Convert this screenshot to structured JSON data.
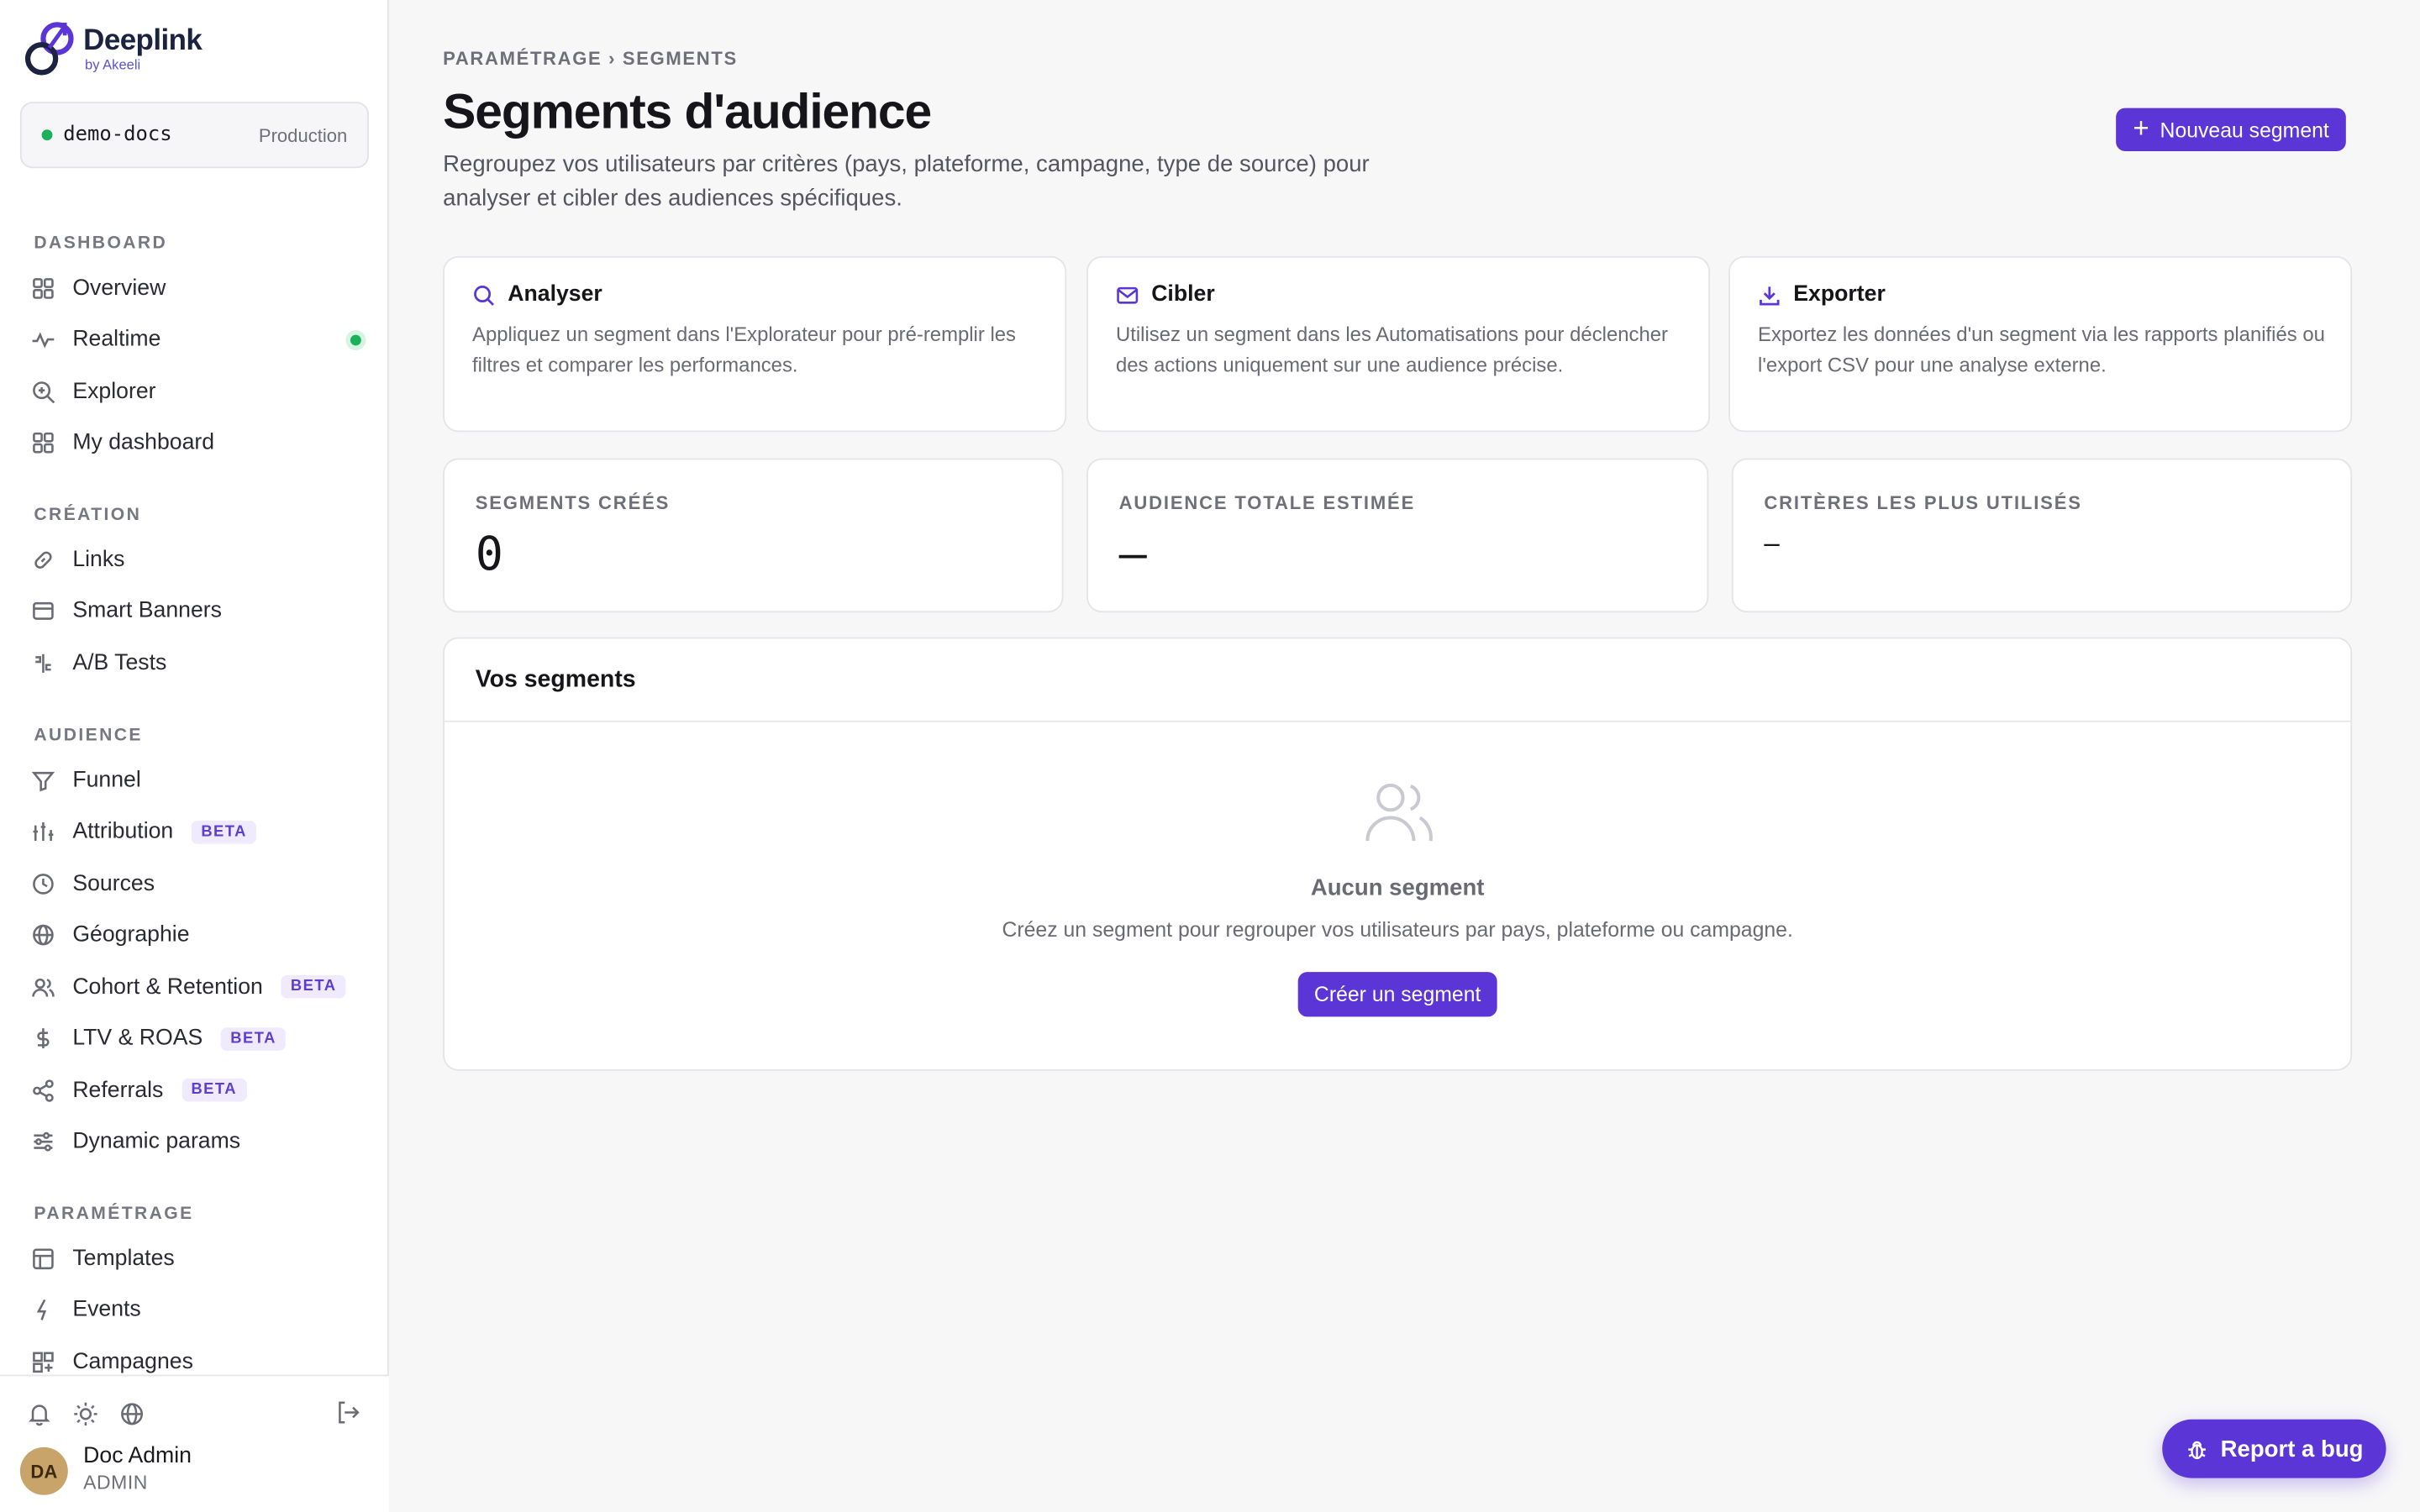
{
  "brand": {
    "name": "Deeplink",
    "sub": "by Akeeli",
    "accent": "#5b35d5"
  },
  "project": {
    "name": "demo-docs",
    "env": "Production"
  },
  "nav": {
    "dashboard": {
      "title": "DASHBOARD",
      "items": [
        {
          "label": "Overview",
          "icon": "grid-icon"
        },
        {
          "label": "Realtime",
          "icon": "pulse-icon"
        },
        {
          "label": "Explorer",
          "icon": "zoom-icon"
        },
        {
          "label": "My dashboard",
          "icon": "grid-icon"
        }
      ]
    },
    "creation": {
      "title": "CRÉATION",
      "items": [
        {
          "label": "Links",
          "icon": "link-icon"
        },
        {
          "label": "Smart Banners",
          "icon": "banner-icon"
        },
        {
          "label": "A/B Tests",
          "icon": "split-icon"
        }
      ]
    },
    "audience": {
      "title": "AUDIENCE",
      "items": [
        {
          "label": "Funnel",
          "icon": "funnel-icon"
        },
        {
          "label": "Attribution",
          "icon": "attribution-icon",
          "badge": "BETA"
        },
        {
          "label": "Sources",
          "icon": "clock-icon"
        },
        {
          "label": "Géographie",
          "icon": "globe-icon"
        },
        {
          "label": "Cohort & Retention",
          "icon": "users-icon",
          "badge": "BETA"
        },
        {
          "label": "LTV & ROAS",
          "icon": "dollar-icon",
          "badge": "BETA"
        },
        {
          "label": "Referrals",
          "icon": "share-icon",
          "badge": "BETA"
        },
        {
          "label": "Dynamic params",
          "icon": "sliders-icon"
        }
      ]
    },
    "parametrage": {
      "title": "PARAMÉTRAGE",
      "items": [
        {
          "label": "Templates",
          "icon": "template-icon"
        },
        {
          "label": "Events",
          "icon": "bolt-icon"
        },
        {
          "label": "Campagnes",
          "icon": "campaign-icon"
        }
      ]
    }
  },
  "user": {
    "initials": "DA",
    "name": "Doc Admin",
    "role": "ADMIN"
  },
  "main": {
    "breadcrumb": "PARAMÉTRAGE › SEGMENTS",
    "title": "Segments d'audience",
    "description": "Regroupez vos utilisateurs par critères (pays, plateforme, campagne, type de source) pour analyser et cibler des audiences spécifiques.",
    "new_button": "Nouveau segment",
    "features": [
      {
        "title": "Analyser",
        "icon": "search-icon",
        "text": "Appliquez un segment dans l'Explorateur pour pré-remplir les filtres et comparer les performances."
      },
      {
        "title": "Cibler",
        "icon": "mail-icon",
        "text": "Utilisez un segment dans les Automatisations pour déclencher des actions uniquement sur une audience précise."
      },
      {
        "title": "Exporter",
        "icon": "download-icon",
        "text": "Exportez les données d'un segment via les rapports planifiés ou l'export CSV pour une analyse externe."
      }
    ],
    "stats": [
      {
        "label": "SEGMENTS CRÉÉS",
        "value": "0"
      },
      {
        "label": "AUDIENCE TOTALE ESTIMÉE",
        "value": "—"
      },
      {
        "label": "CRITÈRES LES PLUS UTILISÉS",
        "value": "–"
      }
    ],
    "segments": {
      "title": "Vos segments",
      "empty_title": "Aucun segment",
      "empty_text": "Créez un segment pour regrouper vos utilisateurs par pays, plateforme ou campagne.",
      "create_button": "Créer un segment"
    }
  },
  "report_bug": "Report a bug"
}
